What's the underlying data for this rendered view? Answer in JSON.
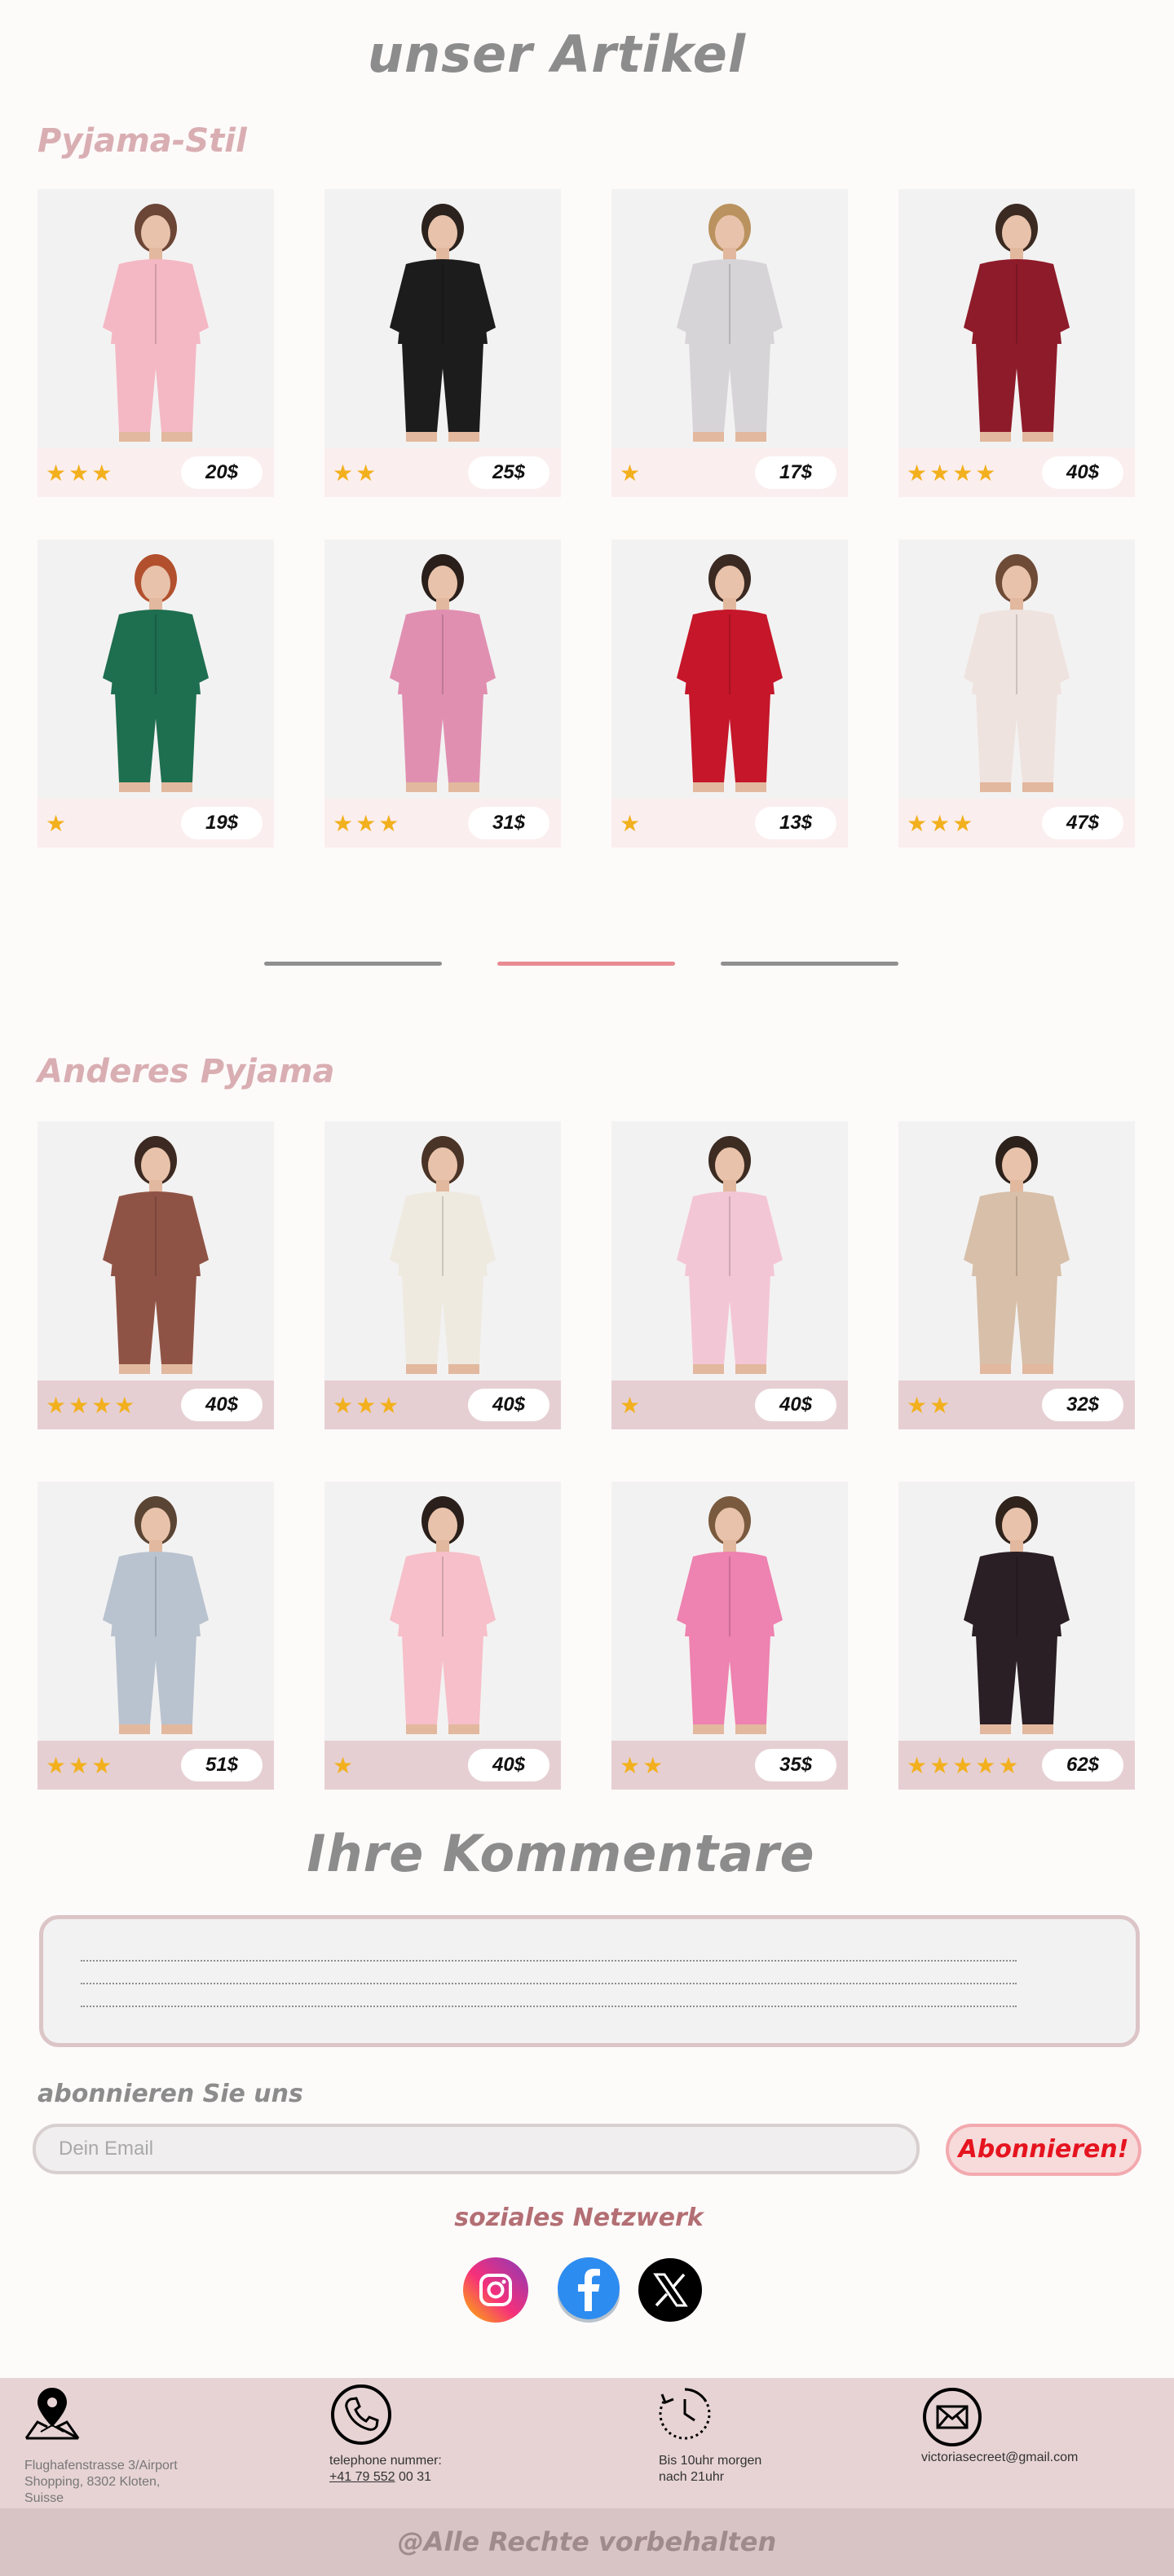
{
  "page": {
    "title": "unser  Artikel"
  },
  "section1": {
    "title": "Pyjama-Stil",
    "items": [
      {
        "stars": "★★★",
        "price": "20$",
        "color": "#f4b8c4",
        "hair": "#6b4536"
      },
      {
        "stars": "★★",
        "price": "25$",
        "color": "#1c1c1c",
        "hair": "#2b221d"
      },
      {
        "stars": "★",
        "price": "17$",
        "color": "#d7d4d8",
        "hair": "#b9925f"
      },
      {
        "stars": "★★★★",
        "price": "40$",
        "color": "#8e1b2a",
        "hair": "#3a2a22"
      },
      {
        "stars": "★",
        "price": "19$",
        "color": "#1e6e50",
        "hair": "#b2502e"
      },
      {
        "stars": "★★★",
        "price": "31$",
        "color": "#e08fb1",
        "hair": "#2a1f1a"
      },
      {
        "stars": "★",
        "price": "13$",
        "color": "#c5162a",
        "hair": "#3a2a22"
      },
      {
        "stars": "★★★",
        "price": "47$",
        "color": "#efe3df",
        "hair": "#6e4b37"
      }
    ]
  },
  "section2": {
    "title": "Anderes Pyjama",
    "items": [
      {
        "stars": "★★★★",
        "price": "40$",
        "color": "#8f5345",
        "hair": "#3c2a22"
      },
      {
        "stars": "★★★",
        "price": "40$",
        "color": "#eeeae0",
        "hair": "#4a3427"
      },
      {
        "stars": "★",
        "price": "40$",
        "color": "#f3c6d6",
        "hair": "#3d2c22"
      },
      {
        "stars": "★★",
        "price": "32$",
        "color": "#d7bfa9",
        "hair": "#2d211b"
      },
      {
        "stars": "★★★",
        "price": "51$",
        "color": "#b9c3cf",
        "hair": "#5a4434"
      },
      {
        "stars": "★",
        "price": "40$",
        "color": "#f6bfc9",
        "hair": "#2a1f1a"
      },
      {
        "stars": "★★",
        "price": "35$",
        "color": "#ee82b0",
        "hair": "#7a5a3e"
      },
      {
        "stars": "★★★★★",
        "price": "62$",
        "color": "#2a1f24",
        "hair": "#2f231c"
      }
    ]
  },
  "comments": {
    "title": "Ihre Kommentare"
  },
  "subscribe": {
    "title": "abonnieren Sie uns",
    "placeholder": "Dein Email",
    "button": "Abonnieren!"
  },
  "social": {
    "title": "soziales Netzwerk",
    "icons": [
      "instagram-icon",
      "facebook-icon",
      "x-icon"
    ]
  },
  "footer": {
    "address": [
      "Flughafenstrasse 3/Airport",
      "Shopping, 8302 Kloten,",
      "Suisse"
    ],
    "phone_label": "telephone nummer:",
    "phone_number_underlined": "+41 79 552",
    "phone_number_rest": " 00 31",
    "hours": [
      "Bis 10uhr morgen",
      "nach 21uhr"
    ],
    "email": "victoriasecreet@gmail.com",
    "copyright": "@Alle Rechte vorbehalten"
  }
}
